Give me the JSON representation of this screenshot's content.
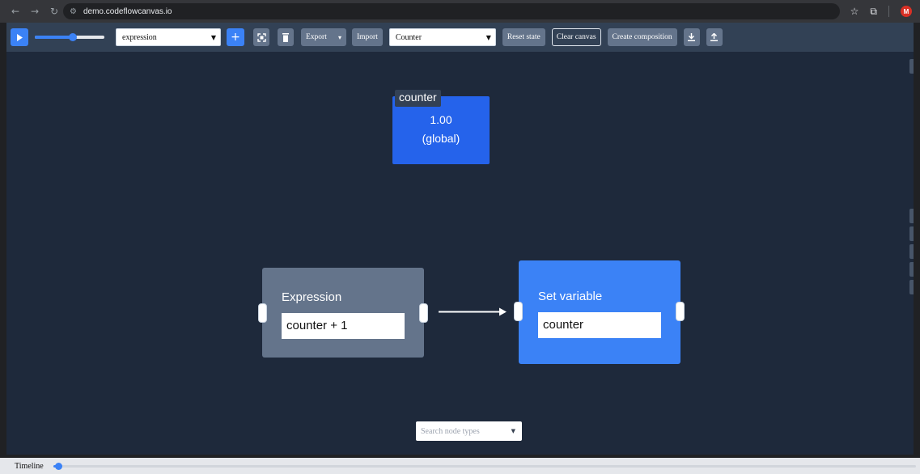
{
  "browser": {
    "url": "demo.codeflowcanvas.io",
    "avatar_initial": "M",
    "icons": [
      "back-icon",
      "forward-icon",
      "reload-icon",
      "site-settings-icon",
      "star-icon",
      "extensions-icon"
    ]
  },
  "toolbar": {
    "speed_slider_value": 0.55,
    "node_type_select": "expression",
    "add_label": "+",
    "export_label": "Export",
    "export_chevron": "▾",
    "import_label": "Import",
    "flow_select": "Counter",
    "reset_label": "Reset state",
    "clear_label": "Clear canvas",
    "create_composition_label": "Create composition",
    "accent_color": "#3b82f6"
  },
  "canvas": {
    "variable_node": {
      "name": "counter",
      "value": "1.00",
      "scope": "(global)"
    },
    "expression_node": {
      "title": "Expression",
      "input_value": "counter + 1"
    },
    "set_variable_node": {
      "title": "Set variable",
      "input_value": "counter"
    },
    "search": {
      "placeholder": "Search node types"
    }
  },
  "timeline": {
    "label": "Timeline",
    "position": 0.0
  }
}
